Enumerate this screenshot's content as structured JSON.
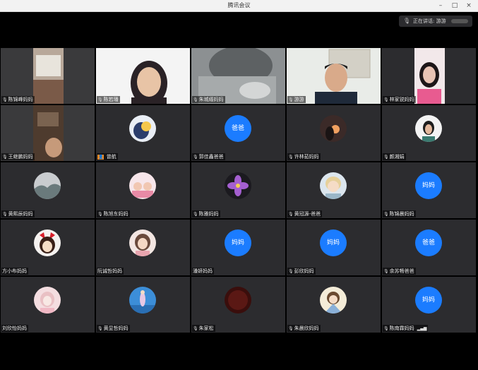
{
  "window": {
    "title": "腾讯会议",
    "btn_min": "–",
    "btn_max": "□",
    "btn_close": "×"
  },
  "speaker": {
    "text": "正在讲话: 游游"
  },
  "tiles": [
    {
      "name": "陈锦峰妈妈",
      "avatar": null
    },
    {
      "name": "陈若璠",
      "avatar": null
    },
    {
      "name": "朱城缙妈妈",
      "avatar": null
    },
    {
      "name": "游游",
      "avatar": null
    },
    {
      "name": "林家锐妈妈",
      "avatar": null
    },
    {
      "name": "王继鹏妈妈",
      "avatar": null
    },
    {
      "name": "曾航",
      "avatar": null
    },
    {
      "name": "郭佳鑫爸爸",
      "avatar": "爸爸"
    },
    {
      "name": "许林茹妈妈",
      "avatar": null
    },
    {
      "name": "颜湘娟",
      "avatar": null
    },
    {
      "name": "黄熙辰妈妈",
      "avatar": null
    },
    {
      "name": "陈旭东妈妈",
      "avatar": null
    },
    {
      "name": "陈雅妈妈",
      "avatar": null
    },
    {
      "name": "黄冠源-爸爸",
      "avatar": null
    },
    {
      "name": "陈锦晨妈妈",
      "avatar": "妈妈"
    },
    {
      "name": "方小布妈妈",
      "avatar": null
    },
    {
      "name": "阮诚哲妈妈",
      "avatar": null
    },
    {
      "name": "潘妍妈妈",
      "avatar": "妈妈"
    },
    {
      "name": "彭欣妈妈",
      "avatar": "妈妈"
    },
    {
      "name": "余苏畅爸爸",
      "avatar": "爸爸"
    },
    {
      "name": "刘欣怡妈妈",
      "avatar": null
    },
    {
      "name": "黄显哲妈妈",
      "avatar": null
    },
    {
      "name": "朱家松",
      "avatar": null
    },
    {
      "name": "朱晨欣妈妈",
      "avatar": null
    },
    {
      "name": "陈南霖妈妈",
      "avatar": "妈妈"
    }
  ]
}
